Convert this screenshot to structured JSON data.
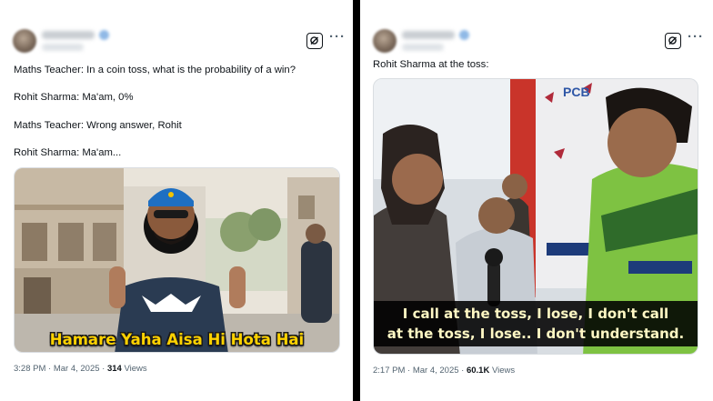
{
  "left_tweet": {
    "lines": [
      "Maths Teacher: In a coin toss, what is the probability of a win?",
      "Rohit Sharma: Ma'am, 0%",
      "Maths Teacher: Wrong answer, Rohit",
      "Rohit Sharma: Ma'am..."
    ],
    "image_caption": "Hamare Yaha Aisa Hi Hota Hai",
    "footer": {
      "timestamp": "3:28 PM · Mar 4, 2025 · ",
      "views": "314",
      "views_label": " Views"
    }
  },
  "right_tweet": {
    "lines": [
      "Rohit Sharma at the toss:"
    ],
    "subtitle": [
      "I call at the toss, I lose, I don't call",
      "at the toss, I lose.. I don't understand."
    ],
    "sign_text": "PCB",
    "footer": {
      "timestamp": "2:17 PM · Mar 4, 2025 · ",
      "views": "60.1K",
      "views_label": " Views"
    }
  },
  "icons": {
    "grok": "grok-icon",
    "more": "more-icon"
  },
  "more_glyph": "···",
  "colors": {
    "caption_yellow": "#ffd200",
    "divider": "#000000",
    "muted": "#536471"
  }
}
